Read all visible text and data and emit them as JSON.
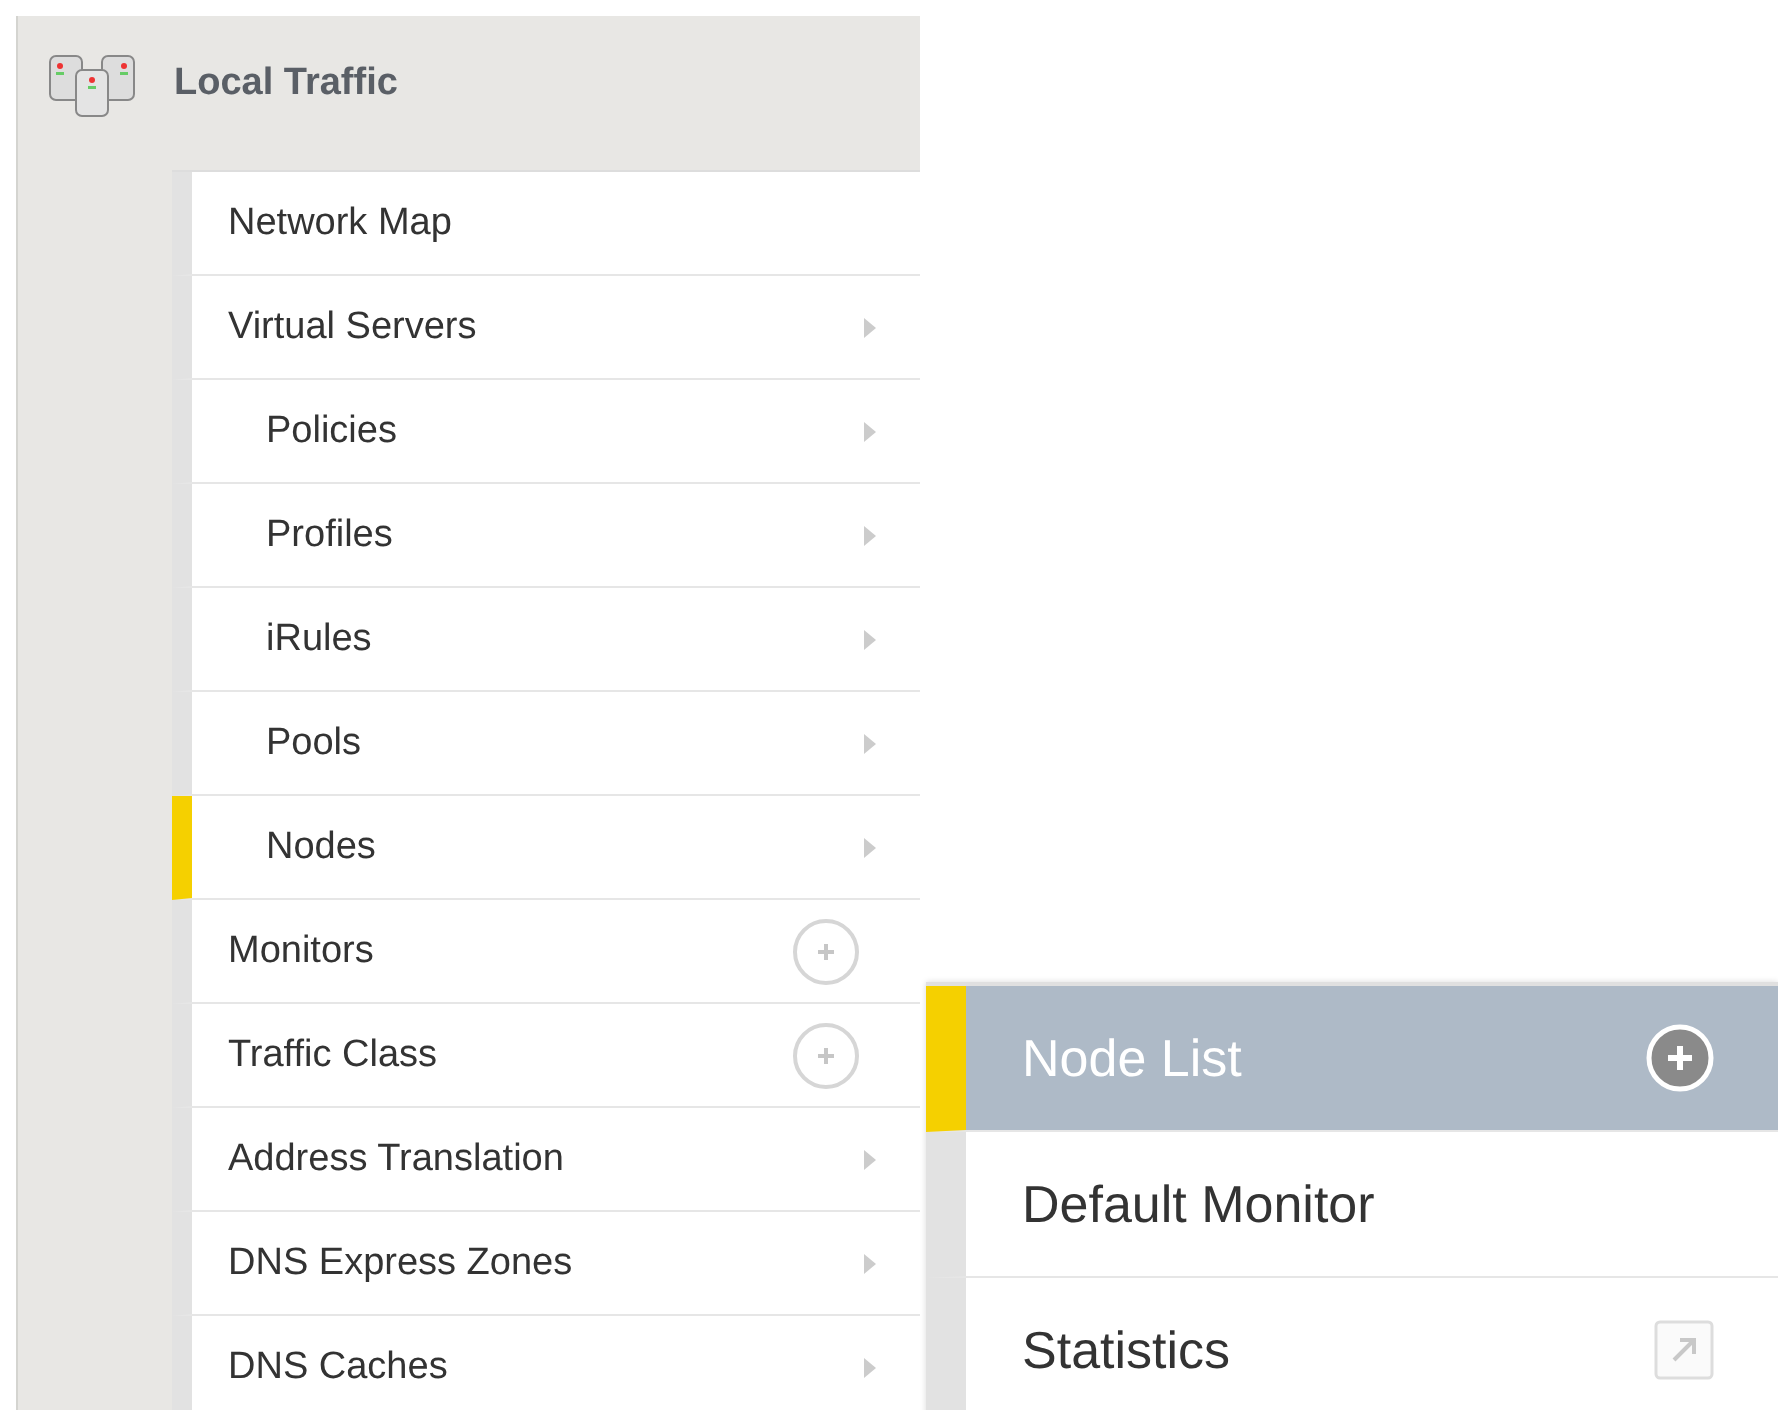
{
  "section": {
    "title": "Local Traffic"
  },
  "menu": [
    {
      "label": "Network Map",
      "kind": "plain",
      "selected": false
    },
    {
      "label": "Virtual Servers",
      "kind": "arrow",
      "selected": false,
      "children": [
        {
          "label": "Policies",
          "kind": "arrow",
          "selected": false
        },
        {
          "label": "Profiles",
          "kind": "arrow",
          "selected": false
        },
        {
          "label": "iRules",
          "kind": "arrow",
          "selected": false
        },
        {
          "label": "Pools",
          "kind": "arrow",
          "selected": false
        },
        {
          "label": "Nodes",
          "kind": "arrow",
          "selected": true
        }
      ]
    },
    {
      "label": "Monitors",
      "kind": "add",
      "selected": false
    },
    {
      "label": "Traffic Class",
      "kind": "add",
      "selected": false
    },
    {
      "label": "Address Translation",
      "kind": "arrow",
      "selected": false
    },
    {
      "label": "DNS Express Zones",
      "kind": "arrow",
      "selected": false
    },
    {
      "label": "DNS Caches",
      "kind": "arrow",
      "selected": false
    }
  ],
  "submenu": [
    {
      "label": "Node List",
      "kind": "add",
      "selected": true
    },
    {
      "label": "Default Monitor",
      "kind": "plain",
      "selected": false
    },
    {
      "label": "Statistics",
      "kind": "external",
      "selected": false
    }
  ]
}
